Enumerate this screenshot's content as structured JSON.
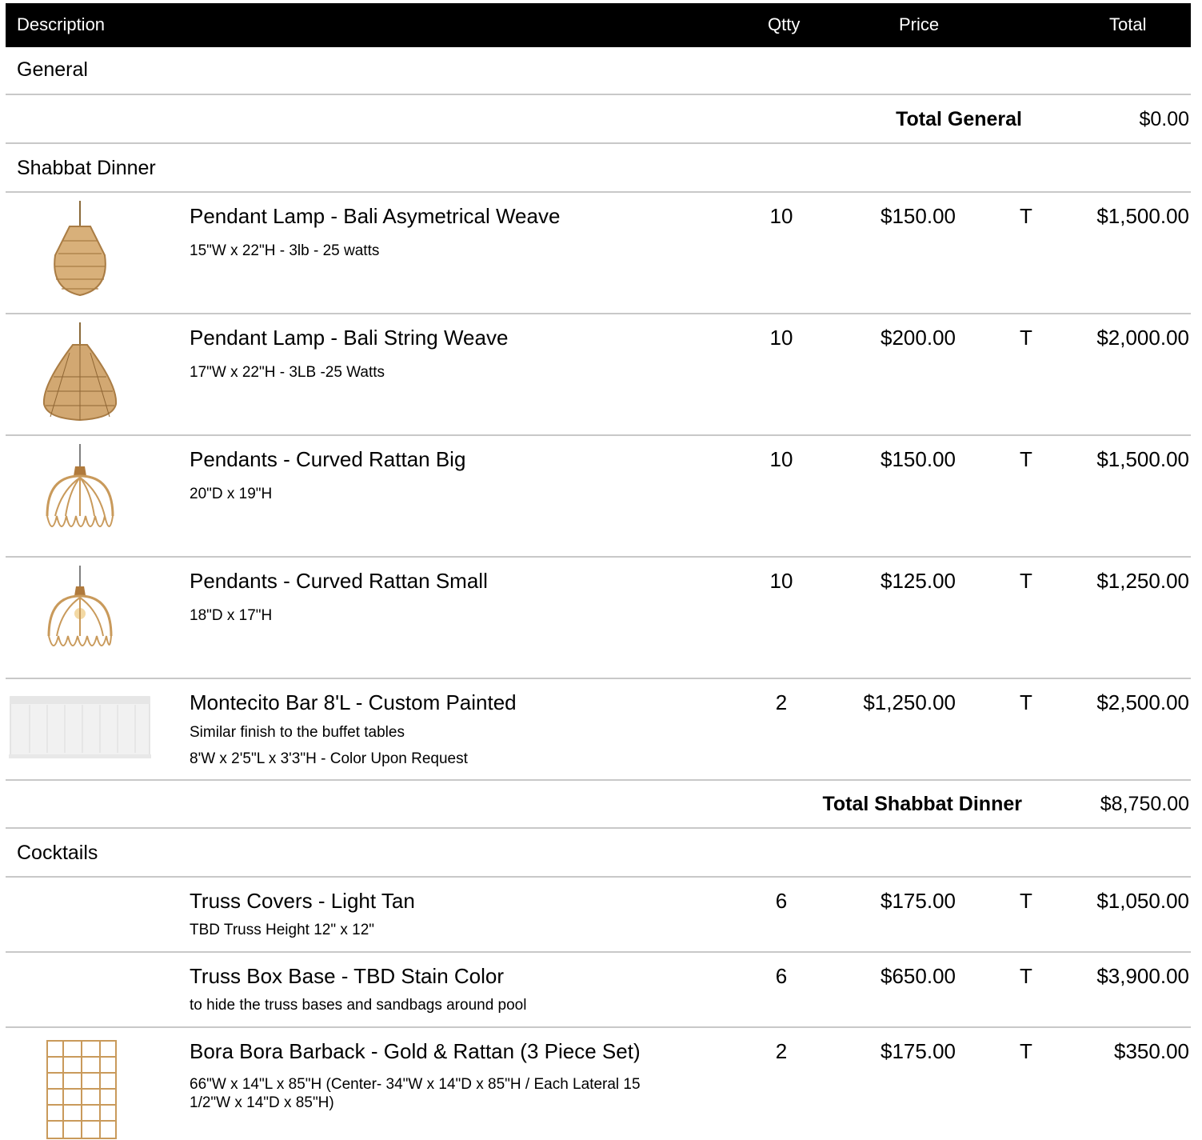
{
  "header": {
    "description": "Description",
    "qty": "Qtty",
    "price": "Price",
    "total": "Total"
  },
  "sections": {
    "general": {
      "title": "General",
      "total_label": "Total General",
      "total_value": "$0.00"
    },
    "shabbat": {
      "title": "Shabbat Dinner",
      "total_label": "Total Shabbat Dinner",
      "total_value": "$8,750.00",
      "items": [
        {
          "name": "Pendant Lamp - Bali Asymetrical Weave",
          "desc": [
            "15\"W x 22\"H - 3lb - 25 watts"
          ],
          "qty": "10",
          "price": "$150.00",
          "tax": "T",
          "total": "$1,500.00",
          "icon": "woven-pendant-lamp-icon"
        },
        {
          "name": "Pendant Lamp - Bali String Weave",
          "desc": [
            "17\"W x 22\"H - 3LB -25 Watts"
          ],
          "qty": "10",
          "price": "$200.00",
          "tax": "T",
          "total": "$2,000.00",
          "icon": "string-weave-pendant-icon"
        },
        {
          "name": "Pendants - Curved Rattan Big",
          "desc": [
            "20\"D x 19\"H"
          ],
          "qty": "10",
          "price": "$150.00",
          "tax": "T",
          "total": "$1,500.00",
          "icon": "curved-rattan-pendant-icon"
        },
        {
          "name": "Pendants - Curved Rattan Small",
          "desc": [
            "18\"D x 17\"H"
          ],
          "qty": "10",
          "price": "$125.00",
          "tax": "T",
          "total": "$1,250.00",
          "icon": "curved-rattan-pendant-small-icon"
        },
        {
          "name": "Montecito Bar 8'L - Custom Painted",
          "desc": [
            "Similar finish to the buffet tables",
            "8'W x 2'5\"L x 3'3\"H - Color Upon Request"
          ],
          "qty": "2",
          "price": "$1,250.00",
          "tax": "T",
          "total": "$2,500.00",
          "icon": "white-bar-icon"
        }
      ]
    },
    "cocktails": {
      "title": "Cocktails",
      "items": [
        {
          "name": "Truss Covers - Light Tan",
          "desc": [
            "TBD Truss Height 12\" x 12\""
          ],
          "qty": "6",
          "price": "$175.00",
          "tax": "T",
          "total": "$1,050.00"
        },
        {
          "name": "Truss Box Base - TBD Stain Color",
          "desc": [
            "to hide the truss bases and sandbags around pool"
          ],
          "qty": "6",
          "price": "$650.00",
          "tax": "T",
          "total": "$3,900.00"
        },
        {
          "name": "Bora Bora Barback - Gold & Rattan (3 Piece Set)",
          "desc": [
            "66\"W x 14\"L x 85\"H   (Center- 34\"W x 14\"D x 85\"H / Each Lateral 15",
            "1/2\"W  x 14\"D x 85\"H)"
          ],
          "qty": "2",
          "price": "$175.00",
          "tax": "T",
          "total": "$350.00",
          "icon": "gold-shelf-barback-icon"
        }
      ]
    }
  },
  "colors": {
    "header_bg": "#000000",
    "rule": "#c8c8c8",
    "rattan": "#c99a5b"
  }
}
